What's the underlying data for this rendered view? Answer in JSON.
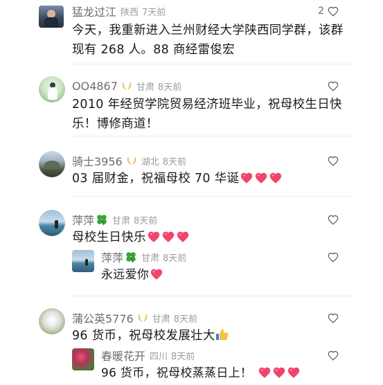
{
  "comments": [
    {
      "name": "猛龙过江",
      "region": "陕西",
      "time": "7天前",
      "likes": "2",
      "text_line1": "今天，我重新进入兰州财经大学陕西同学群，该群",
      "text_line2": "现有 268 人。88 商经雷俊宏"
    },
    {
      "name": "OO4867",
      "region": "甘肃",
      "time": "8天前",
      "text_line1": "2010 年经贸学院贸易经济班毕业，祝母校生日快",
      "text_line2": "乐！博修商道！"
    },
    {
      "name": "骑士3956",
      "region": "湖北",
      "time": "8天前",
      "text": "03 届财金，祝福母校 70 华诞"
    },
    {
      "name": "萍萍",
      "region": "甘肃",
      "time": "8天前",
      "text": "母校生日快乐",
      "reply": {
        "name": "萍萍",
        "region": "甘肃",
        "time": "8天前",
        "text": "永远爱你"
      }
    },
    {
      "name": "蒲公英5776",
      "region": "甘肃",
      "time": "8天前",
      "text": "96 货币，祝母校发展壮大",
      "reply": {
        "name": "春暖花开",
        "region": "四川",
        "time": "8天前",
        "text": "96 货币，祝母校蒸蒸日上！"
      }
    }
  ],
  "icons": {
    "like": "heart-outline-icon",
    "heart_emoji": "red-heart-emoji",
    "clover_emoji": "four-leaf-clover-emoji",
    "thumbs_up": "thumbs-up-emoji",
    "fan_badge": "laurel-badge-icon"
  },
  "colors": {
    "name": "#6d6d6d",
    "meta": "#9b9b9b",
    "text": "#1a1a1a",
    "heart": "#f0456b",
    "badge": "#e8b84a",
    "clover": "#3aa335"
  }
}
